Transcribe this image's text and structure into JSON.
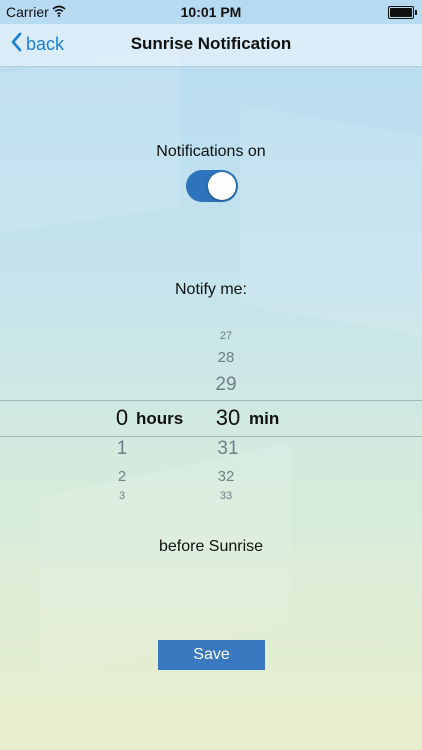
{
  "status_bar": {
    "carrier": "Carrier",
    "time": "10:01 PM"
  },
  "nav": {
    "back_label": "back",
    "title": "Sunrise Notification"
  },
  "notifications": {
    "label": "Notifications on",
    "enabled": true
  },
  "notify": {
    "label": "Notify me:"
  },
  "picker": {
    "hours": {
      "selected": "0",
      "unit": "hours",
      "below": [
        "1",
        "2",
        "3"
      ]
    },
    "minutes": {
      "above": [
        "27",
        "28",
        "29"
      ],
      "selected": "30",
      "unit": "min",
      "below": [
        "31",
        "32",
        "33"
      ]
    }
  },
  "before_label": "before Sunrise",
  "save_label": "Save",
  "colors": {
    "accent": "#1a7fd8",
    "toggle_on": "#2e74bd",
    "button": "#3a78c0"
  }
}
